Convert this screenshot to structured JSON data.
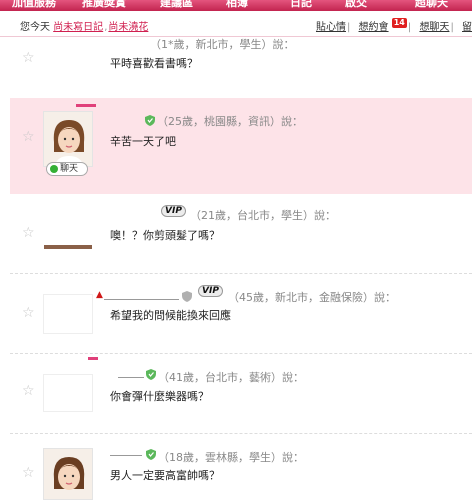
{
  "nav": {
    "items": [
      "加值服務",
      "推廣獎賞",
      "建議區",
      "相簿",
      "日記",
      "啟交",
      "超聊天"
    ]
  },
  "status": {
    "prefix": "您今天",
    "diary_link": "尚未寫日記",
    "flower_link": "尚未澆花",
    "right_links": [
      "貼心情",
      "想約會",
      "想聊天"
    ],
    "date_badge": "14",
    "trailing": "留"
  },
  "posts": [
    {
      "meta": "（1*歲，新北市，學生）說：",
      "message": "平時喜歡看書嗎？"
    },
    {
      "meta": "（25歲，桃園縣，資訊）說：",
      "message": "辛苦一天了吧",
      "chat_label": "聊天"
    },
    {
      "vip": "VIP",
      "meta": "（21歲，台北市，學生）說：",
      "message": "噢！？你剪頭髮了嗎？"
    },
    {
      "vip": "VIP",
      "meta": "（45歲，新北市，金融保險）說：",
      "message": "希望我的問候能換來回應"
    },
    {
      "meta": "（41歲，台北市，藝術）說：",
      "message": "你會彈什麼樂器嗎？"
    },
    {
      "meta": "（18歲，雲林縣，學生）說：",
      "message": "男人一定要高富帥嗎？"
    }
  ],
  "icons": {
    "star": "star-outline-icon",
    "shield": "verified-shield-icon",
    "chat_dot": "online-dot-icon"
  },
  "colors": {
    "accent": "#d02050",
    "highlight": "#fde3e8",
    "shield": "#5bb85b"
  }
}
